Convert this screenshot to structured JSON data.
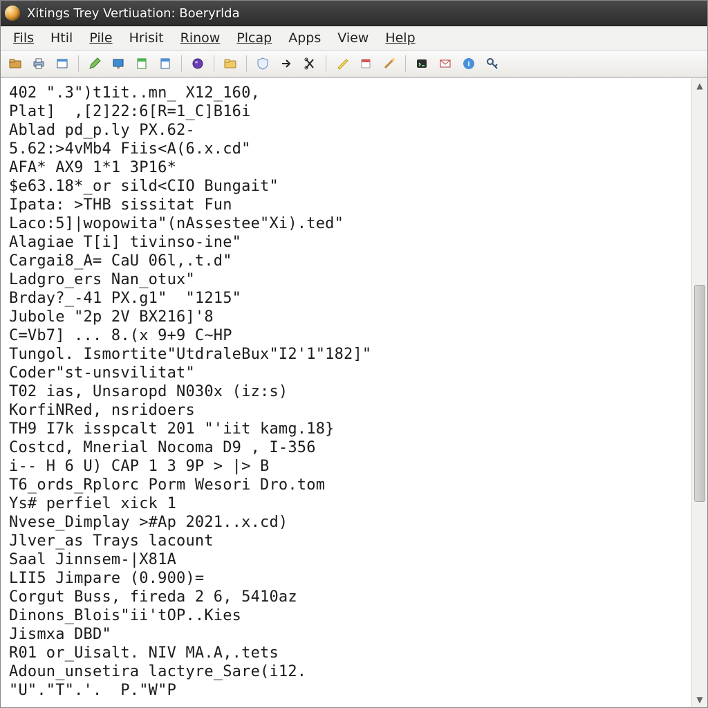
{
  "window": {
    "title": "Xitings Trey Vertiuation: Boeryrlda"
  },
  "menu": {
    "items": [
      {
        "label": "Fils"
      },
      {
        "label": "Htil"
      },
      {
        "label": "Pile"
      },
      {
        "label": "Hrisit"
      },
      {
        "label": "Rinow"
      },
      {
        "label": "Plcap"
      },
      {
        "label": "Apps"
      },
      {
        "label": "View"
      },
      {
        "label": "Help"
      }
    ]
  },
  "toolbar": {
    "groups": [
      [
        "folder-open-icon",
        "printer-icon",
        "window-icon"
      ],
      [
        "pencil-icon",
        "screen-icon",
        "page-green-icon",
        "page-blue-icon"
      ],
      [
        "sphere-icon"
      ],
      [
        "folder-yellow-icon"
      ],
      [
        "shield-icon",
        "arrow-right-icon",
        "scissors-icon"
      ],
      [
        "highlighter-icon",
        "tag-red-icon",
        "wand-icon"
      ],
      [
        "terminal-icon",
        "mail-icon",
        "info-icon",
        "key-icon"
      ]
    ]
  },
  "content": {
    "lines": [
      "402 \".3\")t1it..mn_ X12_160,",
      "Plat]  ,[2]22:6[R=1_C]B16i",
      "Ablad pd_p.ly PX.62-",
      "5.62:>4vMb4 Fiis<A(6.x.cd\"",
      "AFA* AX9 1*1 3P16*",
      "$e63.18*_or sild<CIO Bungait\"",
      "Ipata: >THB sissitat Fun",
      "Laco:5]|wopowita\"(nAssestee\"Xi).ted\"",
      "Alagiae T[i] tivinso-ine\"",
      "Cargai8_A= CaU 06l,.t.d\"",
      "Ladgro_ers Nan_otux\"",
      "Brday?_-41 PX.g1\"  \"1215\"",
      "Jubole \"2p 2V BX216]'8",
      "C=Vb7] ... 8.(x 9+9 C~HP",
      "Tungol. Ismortite\"UtdraleBux\"I2'1\"182]\"",
      "Coder\"st-unsvilitat\"",
      "T02 ias, Unsaropd N030x (iz:s)",
      "KorfiNRed, nsridoers",
      "TH9 I7k isspcalt 201 \"'iit kamg.18}",
      "Costcd, Mnerial Nocoma D9 , I-356",
      "i-- H 6 U) CAP 1 3 9P > |> B",
      "T6_ords_Rplorc Porm Wesori Dro.tom",
      "Ys# perfiel xick 1",
      "Nvese_Dimplay >#Ap 2021..x.cd)",
      "Jlver_as Trays lacount",
      "Saal Jinnsem-|X81A",
      "LII5 Jimpare (0.900)=",
      "Corgut Buss, fireda 2 6, 5410az",
      "Dinons_Blois\"ii'tOP..Kies",
      "Jismxa DBD\"",
      "R01 or_Uisalt. NIV MA.A,.tets",
      "Adoun_unsetira lactyre_Sare(i12.",
      "\"U\".\"T\".'.  P.\"W\"P"
    ]
  }
}
